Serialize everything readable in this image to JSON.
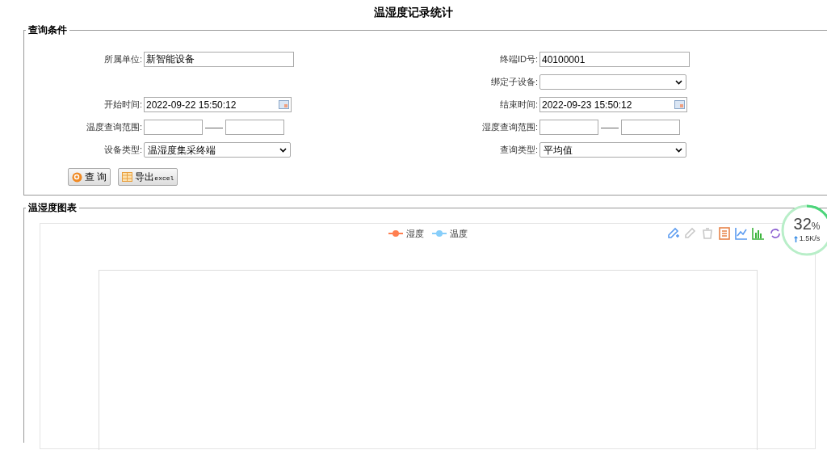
{
  "title": "温湿度记录统计",
  "query": {
    "legend": "查询条件",
    "rows": [
      {
        "left": {
          "kind": "text",
          "label": "所属单位:",
          "value": "新智能设备"
        },
        "right": {
          "kind": "text",
          "label": "终端ID号:",
          "value": "40100001"
        }
      },
      {
        "right": {
          "kind": "select",
          "label": "绑定子设备:"
        }
      },
      {
        "left": {
          "kind": "date",
          "label": "开始时间:",
          "value": "2022-09-22 15:50:12"
        },
        "right": {
          "kind": "date",
          "label": "结束时间:",
          "value": "2022-09-23 15:50:12"
        }
      },
      {
        "left": {
          "kind": "range",
          "label": "温度查询范围:",
          "separator": "——"
        },
        "right": {
          "kind": "range",
          "label": "湿度查询范围:",
          "separator": "——"
        }
      },
      {
        "left": {
          "kind": "select",
          "label": "设备类型:",
          "value": "温湿度集采终端"
        },
        "right": {
          "kind": "select",
          "label": "查询类型:",
          "value": "平均值"
        }
      }
    ],
    "buttons": [
      {
        "kind": "search",
        "label": "查 询"
      },
      {
        "kind": "export",
        "label": "导出",
        "suffix": "excel"
      }
    ]
  },
  "chart": {
    "legend": "温湿度图表",
    "series": [
      {
        "name": "湿度",
        "color": "#ff7f50"
      },
      {
        "name": "温度",
        "color": "#87cefa"
      }
    ],
    "toolbox": [
      {
        "kind": "zoom",
        "disabled": false
      },
      {
        "kind": "back",
        "disabled": true
      },
      {
        "kind": "clear",
        "disabled": true
      },
      {
        "kind": "data",
        "disabled": false
      },
      {
        "kind": "line",
        "disabled": false
      },
      {
        "kind": "bar",
        "disabled": false
      },
      {
        "kind": "restore",
        "disabled": false
      }
    ]
  },
  "monitor": {
    "percent": "32",
    "unit": "%",
    "speed": "1.5K/s"
  }
}
